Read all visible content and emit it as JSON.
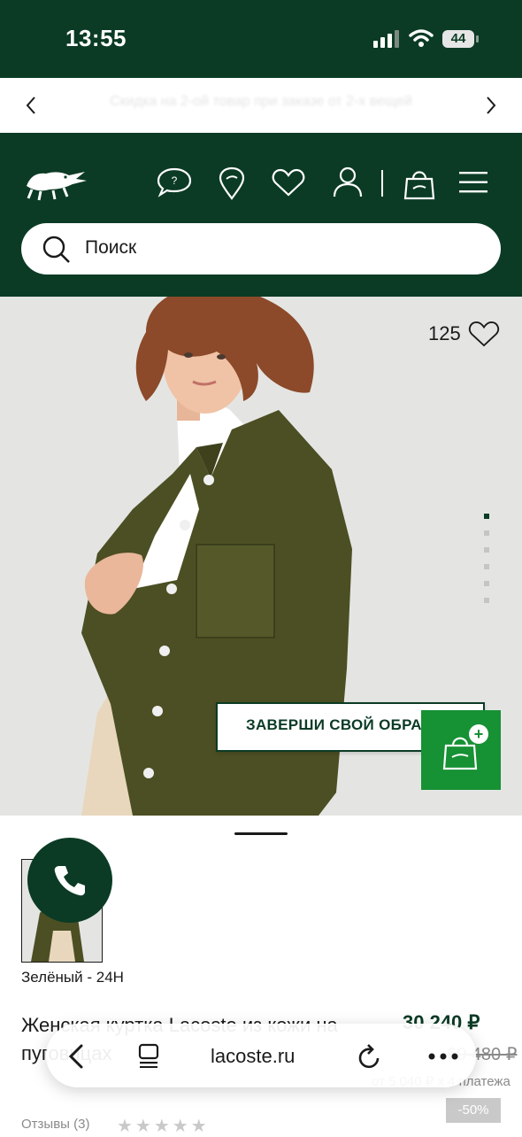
{
  "status_bar": {
    "time": "13:55",
    "battery": "44"
  },
  "promo": {
    "text": "Скидка на 2-ой товар при заказе от 2-х вещей"
  },
  "search": {
    "placeholder": "Поиск"
  },
  "hero": {
    "likes_count": "125",
    "cta_label": "ЗАВЕРШИ СВОЙ ОБРАЗ",
    "slide_count": 6,
    "active_slide": 1
  },
  "product": {
    "color_label": "Зелёный - 24H",
    "title": "Женская куртка Lacoste из кожи на пуговицах",
    "price": "30 240 ₽",
    "old_price": "60 480 ₽",
    "installment": "от 5 040 ₽ x 4 платежа",
    "discount": "-50%",
    "reviews": "Отзывы (3)",
    "rating": 0
  },
  "browser": {
    "url": "lacoste.ru"
  },
  "colors": {
    "brand_green": "#0b3b25",
    "accent_green": "#169134",
    "hero_bg": "#e4e5e3"
  }
}
